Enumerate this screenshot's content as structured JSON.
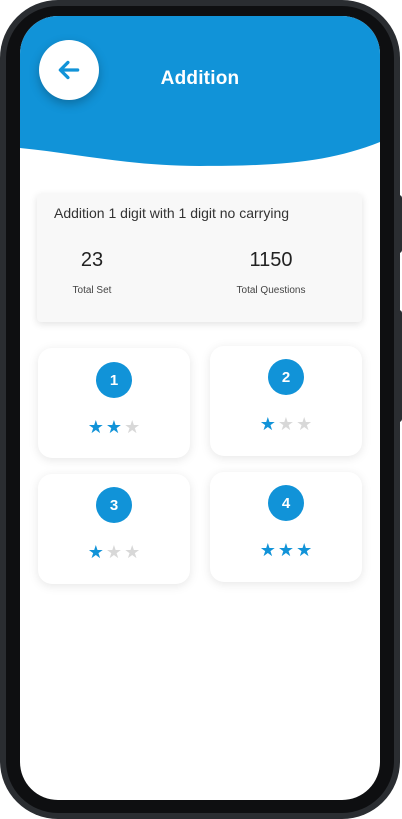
{
  "header": {
    "title": "Addition"
  },
  "summary": {
    "title": "Addition 1 digit with 1 digit no carrying",
    "total_set": {
      "value": "23",
      "label": "Total Set"
    },
    "total_questions": {
      "value": "1150",
      "label": "Total Questions"
    }
  },
  "sets": [
    {
      "number": "1",
      "stars": 2,
      "max_stars": 3
    },
    {
      "number": "2",
      "stars": 1,
      "max_stars": 3
    },
    {
      "number": "3",
      "stars": 1,
      "max_stars": 3
    },
    {
      "number": "4",
      "stars": 3,
      "max_stars": 3
    }
  ],
  "colors": {
    "accent": "#1193d8",
    "star_off": "#d8d8d8"
  },
  "icons": {
    "back": "arrow-left-icon",
    "star": "star-icon"
  }
}
